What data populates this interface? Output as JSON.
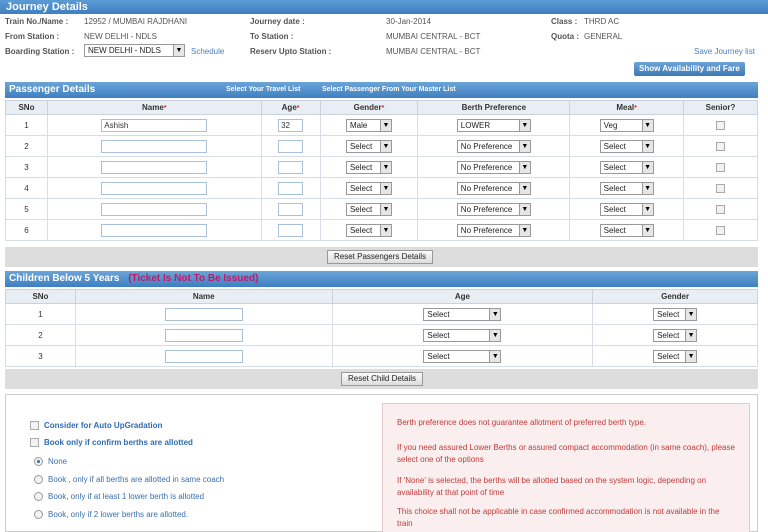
{
  "journey": {
    "title": "Journey Details",
    "train_label": "Train No./Name :",
    "train_value": "12952 / MUMBAI RAJDHANI",
    "date_label": "Journey date :",
    "date_value": "30-Jan-2014",
    "class_label": "Class :",
    "class_value": "THRD AC",
    "from_label": "From Station :",
    "from_value": "NEW DELHI - NDLS",
    "to_label": "To Station :",
    "to_value": "MUMBAI CENTRAL - BCT",
    "quota_label": "Quota :",
    "quota_value": "GENERAL",
    "boarding_label": "Boarding Station :",
    "boarding_value": "NEW DELHI - NDLS",
    "schedule_link": "Schedule",
    "reserv_label": "Reserv Upto Station :",
    "reserv_value": "MUMBAI CENTRAL - BCT",
    "save_link": "Save Journey list",
    "availability_button": "Show Availability and Fare"
  },
  "passengers": {
    "title": "Passenger Details",
    "travel_list_link": "Select Your Travel List",
    "master_list_link": "Select Passenger From Your Master List",
    "columns": {
      "sno": "SNo",
      "name": "Name",
      "age": "Age",
      "gender": "Gender",
      "berth": "Berth Preference",
      "meal": "Meal",
      "senior": "Senior?"
    },
    "required_mark": "*",
    "rows": [
      {
        "sno": "1",
        "name": "Ashish",
        "age": "32",
        "gender": "Male",
        "berth": "LOWER",
        "meal": "Veg"
      },
      {
        "sno": "2",
        "name": "",
        "age": "",
        "gender": "Select",
        "berth": "No Preference",
        "meal": "Select"
      },
      {
        "sno": "3",
        "name": "",
        "age": "",
        "gender": "Select",
        "berth": "No Preference",
        "meal": "Select"
      },
      {
        "sno": "4",
        "name": "",
        "age": "",
        "gender": "Select",
        "berth": "No Preference",
        "meal": "Select"
      },
      {
        "sno": "5",
        "name": "",
        "age": "",
        "gender": "Select",
        "berth": "No Preference",
        "meal": "Select"
      },
      {
        "sno": "6",
        "name": "",
        "age": "",
        "gender": "Select",
        "berth": "No Preference",
        "meal": "Select"
      }
    ],
    "reset_button": "Reset Passengers Details"
  },
  "children": {
    "title": "Children Below 5 Years",
    "note": "(Ticket Is Not To Be Issued)",
    "columns": {
      "sno": "SNo",
      "name": "Name",
      "age": "Age",
      "gender": "Gender"
    },
    "rows": [
      {
        "sno": "1",
        "age": "Select",
        "gender": "Select"
      },
      {
        "sno": "2",
        "age": "Select",
        "gender": "Select"
      },
      {
        "sno": "3",
        "age": "Select",
        "gender": "Select"
      }
    ],
    "reset_button": "Reset Child Details"
  },
  "options": {
    "auto_upgrade": "Consider for Auto UpGradation",
    "confirm_only": "Book only if confirm berths are allotted",
    "radio_none": "None",
    "radio_same_coach": "Book , only if all berths are allotted in same coach",
    "radio_one_lower": "Book, only if at least 1 lower berth is allotted",
    "radio_two_lower": "Book, only if 2 lower berths are allotted."
  },
  "notes": {
    "n1": "Berth preference does not guarantee allotment of preferred berth type.",
    "n2": "If you need assured Lower Berths or assured compact accommodation (in same coach), please select one of the options",
    "n3": "If 'None' is selected, the berths will be allotted based on the system logic, depending on availability at that point of time",
    "n4": "This choice shall not be applicable in case confirmed accommodation is not available in the train"
  }
}
